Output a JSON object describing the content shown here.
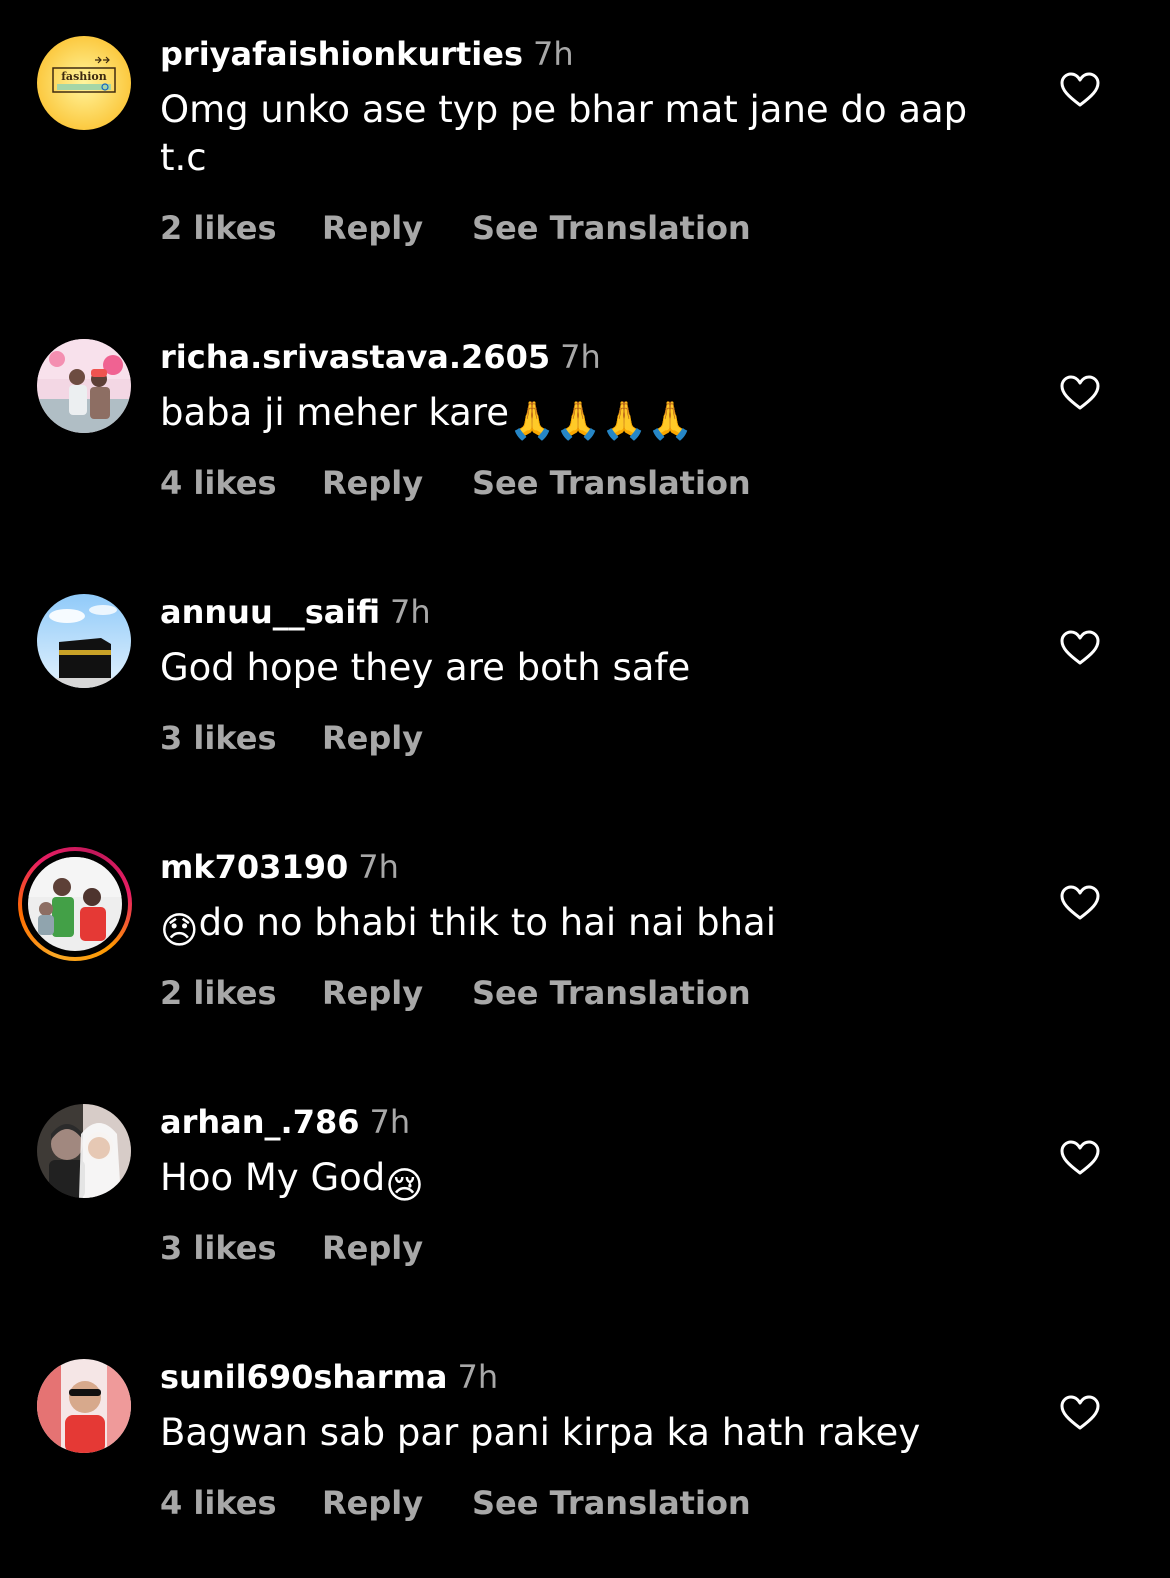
{
  "comments": [
    {
      "username": "priyafaishionkurties",
      "time": "7h",
      "text": "Omg unko ase typ pe bhar mat jane do aap t.c",
      "emoji": "",
      "likes": "2 likes",
      "reply": "Reply",
      "translate": "See Translation"
    },
    {
      "username": "richa.srivastava.2605",
      "time": "7h",
      "text": "baba ji meher kare",
      "emoji": "🙏🙏🙏🙏",
      "likes": "4 likes",
      "reply": "Reply",
      "translate": "See Translation"
    },
    {
      "username": "annuu__saifi",
      "time": "7h",
      "text": "God hope they are both safe",
      "emoji": "",
      "likes": "3 likes",
      "reply": "Reply",
      "translate": ""
    },
    {
      "username": "mk703190",
      "time": "7h",
      "text": "do no bhabi thik to hai nai bhai",
      "emoji": "😞",
      "likes": "2 likes",
      "reply": "Reply",
      "translate": "See Translation"
    },
    {
      "username": "arhan_.786",
      "time": "7h",
      "text": "Hoo My God",
      "emoji": "😢",
      "likes": "3 likes",
      "reply": "Reply",
      "translate": ""
    },
    {
      "username": "sunil690sharma",
      "time": "7h",
      "text": "Bagwan sab par pani kirpa ka hath rakey",
      "emoji": "",
      "likes": "4 likes",
      "reply": "Reply",
      "translate": "See Translation"
    }
  ],
  "avatar1_logo_text": "fashion",
  "colors": {
    "background": "#000000",
    "primary_text": "#ffffff",
    "secondary_text": "#a8a8a8"
  },
  "icons": {
    "like": "heart-outline-icon"
  }
}
